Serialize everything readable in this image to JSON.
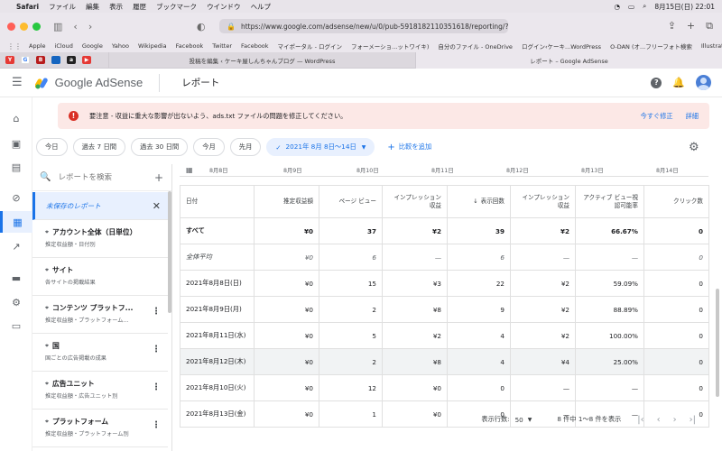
{
  "menubar": {
    "app": "Safari",
    "items": [
      "ファイル",
      "編集",
      "表示",
      "履歴",
      "ブックマーク",
      "ウインドウ",
      "ヘルプ"
    ],
    "clock": "8月15日(日) 22:01"
  },
  "browser": {
    "url": "https://www.google.com/adsense/new/u/0/pub-5918182110351618/reporting/?ag=dateā",
    "bookmarks": [
      "Apple",
      "iCloud",
      "Google",
      "Yahoo",
      "Wikipedia",
      "Facebook",
      "Twitter",
      "Facebook",
      "マイポータル - ログイン",
      "フォーメーショ...ットワイキ)",
      "自分のファイル - OneDrive",
      "ログイン‹ケーキ...WordPress",
      "O-DAN (オ...フリーフォト検索",
      "Illustrations | unDraw"
    ],
    "tabs": [
      {
        "label": "投稿を編集 ‹ ケーキ屋しんちゃんブログ — WordPress",
        "active": false
      },
      {
        "label": "レポート – Google AdSense",
        "active": true
      }
    ]
  },
  "header": {
    "logo_text": "Google AdSense",
    "title": "レポート"
  },
  "banner": {
    "text": "要注意 - 収益に重大な影響が出ないよう、ads.txt ファイルの問題を修正してください。",
    "fix_now": "今すぐ修正",
    "details": "詳細"
  },
  "date_chips": [
    "今日",
    "過去 7 日間",
    "過去 30 日間",
    "今月",
    "先月"
  ],
  "date_selected": "2021年 8月 8日〜14日",
  "add_compare": "比較を追加",
  "reports_panel": {
    "search_placeholder": "レポートを検索",
    "unsaved": "未保存のレポート",
    "items": [
      {
        "title": "アカウント全体（日単位）",
        "sub": "推定収益額・日付別"
      },
      {
        "title": "サイト",
        "sub": "各サイトの掲載結果"
      },
      {
        "title": "コンテンツ プラットフ...",
        "sub": "推定収益額・プラットフォーム..."
      },
      {
        "title": "国",
        "sub": "国ごとの広告掲載の成果"
      },
      {
        "title": "広告ユニット",
        "sub": "推定収益額・広告ユニット別"
      },
      {
        "title": "プラットフォーム",
        "sub": "推定収益額・プラットフォーム別"
      }
    ]
  },
  "chart_axis": [
    "8月8日",
    "8月9日",
    "8月10日",
    "8月11日",
    "8月12日",
    "8月13日",
    "8月14日"
  ],
  "table": {
    "headers": [
      "日付",
      "推定収益額",
      "ページ ビュー",
      "インプレッション収益",
      "表示回数",
      "インプレッション収益",
      "アクティブ ビュー視認可能率",
      "クリック数"
    ],
    "rows": [
      {
        "cls": "total",
        "cells": [
          "すべて",
          "¥0",
          "37",
          "¥2",
          "39",
          "¥2",
          "66.67%",
          "0"
        ]
      },
      {
        "cls": "avg",
        "cells": [
          "全体平均",
          "¥0",
          "6",
          "—",
          "6",
          "—",
          "—",
          "0"
        ]
      },
      {
        "cls": "",
        "cells": [
          "2021年8月8日(日)",
          "¥0",
          "15",
          "¥3",
          "22",
          "¥2",
          "59.09%",
          "0"
        ]
      },
      {
        "cls": "",
        "cells": [
          "2021年8月9日(月)",
          "¥0",
          "2",
          "¥8",
          "9",
          "¥2",
          "88.89%",
          "0"
        ]
      },
      {
        "cls": "",
        "cells": [
          "2021年8月11日(水)",
          "¥0",
          "5",
          "¥2",
          "4",
          "¥2",
          "100.00%",
          "0"
        ]
      },
      {
        "cls": "hl",
        "cells": [
          "2021年8月12日(木)",
          "¥0",
          "2",
          "¥8",
          "4",
          "¥4",
          "25.00%",
          "0"
        ]
      },
      {
        "cls": "",
        "cells": [
          "2021年8月10日(火)",
          "¥0",
          "12",
          "¥0",
          "0",
          "—",
          "—",
          "0"
        ]
      },
      {
        "cls": "",
        "cells": [
          "2021年8月13日(金)",
          "¥0",
          "1",
          "¥0",
          "0",
          "—",
          "—",
          "0"
        ]
      }
    ]
  },
  "pager": {
    "rows_label": "表示行数:",
    "rows_value": "50",
    "range": "8 件中 1〜8 件を表示"
  }
}
